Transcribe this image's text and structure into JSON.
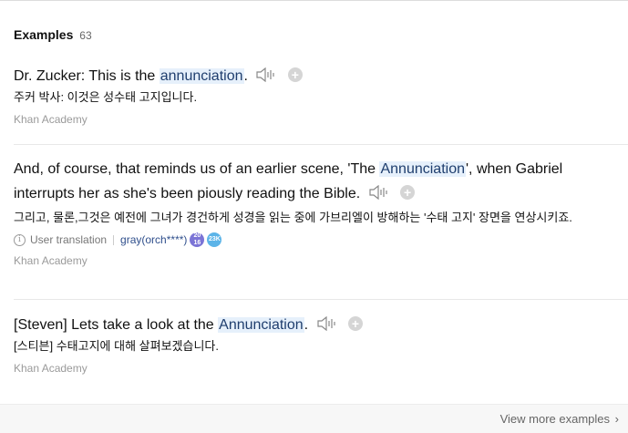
{
  "header": {
    "title": "Examples",
    "count": "63"
  },
  "examples": [
    {
      "en_before": "Dr. Zucker: This is the ",
      "en_highlight": "annunciation",
      "en_after": ".",
      "ko": "주커 박사: 이것은 성수태 고지입니다.",
      "source": "Khan Academy"
    },
    {
      "en_before": "And, of course, that reminds us of an earlier scene, 'The ",
      "en_highlight": "Annunciation",
      "en_after": "', when Gabriel interrupts her as she's been piously reading the Bible.",
      "ko": "그리고, 물론,그것은 예전에 그녀가 경건하게 성경을 읽는 중에 가브리엘이 방해하는 '수태 고지' 장면을 연상시키죠.",
      "meta_label": "User translation",
      "user": "gray(orch****)",
      "badge_1": "20 16",
      "badge_2": "23K",
      "source": "Khan Academy"
    },
    {
      "en_before": "[Steven] Lets take a look at the ",
      "en_highlight": "Annunciation",
      "en_after": ".",
      "ko": "[스티븐] 수태고지에 대해 살펴보겠습니다.",
      "source": "Khan Academy"
    }
  ],
  "footer": {
    "view_more": "View more examples"
  },
  "icons": {
    "speaker": "speaker-icon",
    "add": "plus-circle-icon",
    "info": "info-icon",
    "chevron": "chevron-right-icon"
  }
}
